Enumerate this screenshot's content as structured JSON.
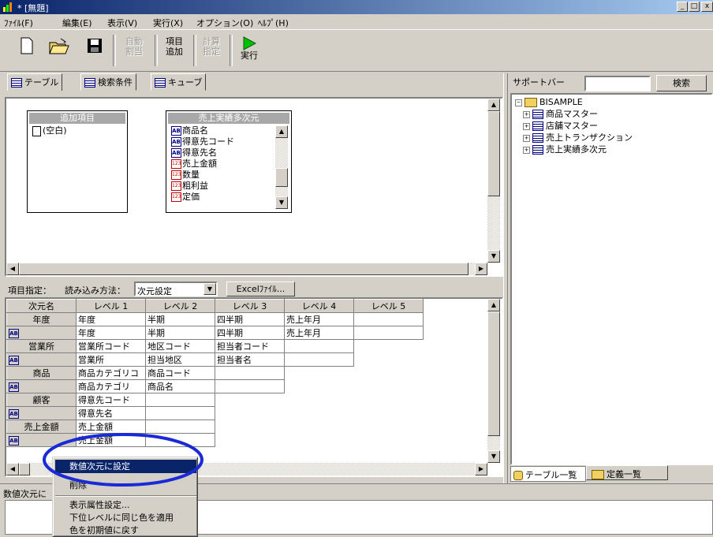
{
  "window": {
    "title": "* [無題]",
    "min": "_",
    "max": "□",
    "close": "x"
  },
  "menu": [
    "ﾌｧｲﾙ(F)",
    "編集(E)",
    "表示(V)",
    "実行(X)",
    "オプション(O)",
    "ﾍﾙﾌﾟ(H)"
  ],
  "toolbar": {
    "auto_assign": "自動\n割当",
    "add_item": "項目\n追加",
    "calc_spec": "計算\n指定",
    "run": "実行"
  },
  "tabs": [
    "テーブル",
    "検索条件",
    "キューブ"
  ],
  "support_bar": {
    "label": "サポートバー",
    "search_value": "",
    "search_button": "検索"
  },
  "add_items_box": {
    "title": "追加項目",
    "items": [
      "(空白)"
    ]
  },
  "sales_box": {
    "title": "売上実績多次元",
    "items": [
      {
        "icon": "AB",
        "label": "商品名"
      },
      {
        "icon": "AB",
        "label": "得意先コード"
      },
      {
        "icon": "AB",
        "label": "得意先名"
      },
      {
        "icon": "123",
        "label": "売上金額"
      },
      {
        "icon": "123",
        "label": "数量"
      },
      {
        "icon": "123",
        "label": "粗利益"
      },
      {
        "icon": "123",
        "label": "定価"
      }
    ]
  },
  "item_spec": {
    "label": "項目指定：",
    "load_method_label": "読み込み方法：",
    "load_method_value": "次元設定",
    "excel_button": "Excelﾌｧｲﾙ..."
  },
  "grid": {
    "headers": [
      "次元名",
      "レベル 1",
      "レベル 2",
      "レベル 3",
      "レベル 4",
      "レベル 5"
    ],
    "rows": [
      {
        "dim": "年度",
        "code": [
          "年度",
          "半期",
          "四半期",
          "売上年月"
        ],
        "name": [
          "年度",
          "半期",
          "四半期",
          "売上年月"
        ]
      },
      {
        "dim": "営業所",
        "code": [
          "営業所コード",
          "地区コード",
          "担当者コード"
        ],
        "name": [
          "営業所",
          "担当地区",
          "担当者名"
        ]
      },
      {
        "dim": "商品",
        "code": [
          "商品カテゴリコ",
          "商品コード"
        ],
        "name": [
          "商品カテゴリ",
          "商品名"
        ]
      },
      {
        "dim": "顧客",
        "code": [
          "得意先コード"
        ],
        "name": [
          "得意先名"
        ]
      },
      {
        "dim": "売上金額",
        "code": [
          "売上金額"
        ],
        "name": [
          "売上金額"
        ]
      }
    ]
  },
  "tree": {
    "root": "BISAMPLE",
    "children": [
      "商品マスター",
      "店舗マスター",
      "売上トランザクション",
      "売上実績多次元"
    ]
  },
  "bottom_tabs": [
    "テーブル一覧",
    "定義一覧"
  ],
  "status": {
    "text": "数値次元に"
  },
  "context_menu": {
    "items": [
      "数値次元に設定",
      "削除",
      "表示属性設定...",
      "下位レベルに同じ色を適用",
      "色を初期値に戻す"
    ]
  },
  "colors": {
    "highlight_ellipse": "#1a2bd6",
    "titlebar": "#0a246a",
    "selection": "#0a246a"
  }
}
